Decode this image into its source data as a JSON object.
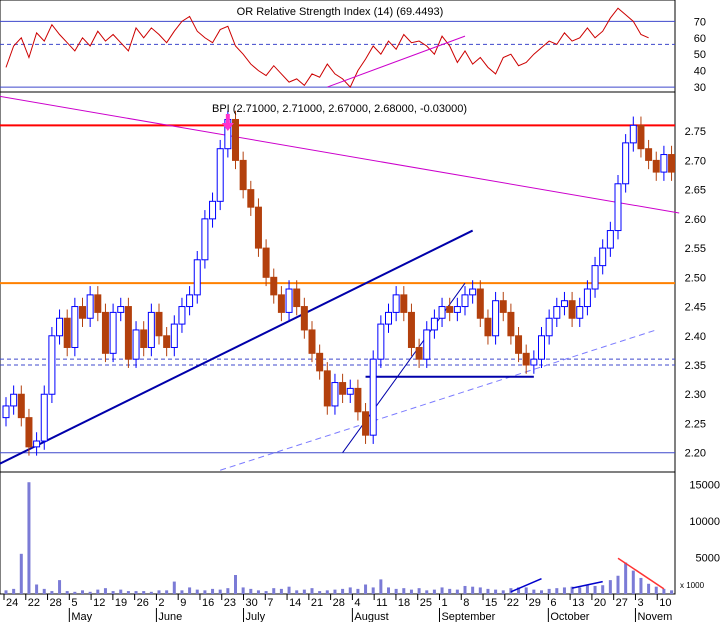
{
  "chart_data": [
    {
      "panel": "rsi",
      "type": "line",
      "title": "OR Relative Strength Index (14) (69.4493)",
      "y_ticks": [
        30,
        40,
        50,
        60,
        70
      ],
      "ylim": [
        27,
        83
      ],
      "reference_lines": [
        70,
        56,
        30
      ],
      "series": [
        {
          "values": [
            42,
            55,
            60,
            48,
            63,
            58,
            68,
            62,
            57,
            52,
            60,
            55,
            64,
            58,
            62,
            57,
            52,
            66,
            60,
            66,
            62,
            57,
            64,
            70,
            73,
            64,
            60,
            57,
            65,
            67,
            55,
            50,
            44,
            40,
            37,
            43,
            38,
            33,
            35,
            31,
            38,
            36,
            44,
            38,
            35,
            30,
            40,
            47,
            55,
            50,
            58,
            53,
            62,
            57,
            58,
            55,
            50,
            61,
            55,
            45,
            52,
            44,
            48,
            42,
            38,
            48,
            50,
            43,
            45,
            50,
            54,
            58,
            56,
            63,
            58,
            60,
            66,
            60,
            64,
            72,
            78,
            74,
            70,
            62,
            60
          ]
        }
      ],
      "trendlines": [
        {
          "from": [
            42,
            30
          ],
          "to": [
            60,
            61
          ]
        }
      ]
    },
    {
      "panel": "price",
      "type": "candlestick",
      "title": "BPI (2.71000, 2.71000, 2.67000, 2.68000, -0.03000)",
      "y_ticks": [
        2.2,
        2.25,
        2.3,
        2.35,
        2.4,
        2.45,
        2.5,
        2.55,
        2.6,
        2.65,
        2.7,
        2.75
      ],
      "ylim": [
        2.167,
        2.817
      ],
      "close": [
        2.28,
        2.3,
        2.26,
        2.21,
        2.22,
        2.3,
        2.4,
        2.43,
        2.38,
        2.45,
        2.43,
        2.47,
        2.44,
        2.37,
        2.44,
        2.45,
        2.36,
        2.41,
        2.38,
        2.44,
        2.4,
        2.38,
        2.42,
        2.45,
        2.47,
        2.53,
        2.6,
        2.63,
        2.72,
        2.77,
        2.7,
        2.65,
        2.62,
        2.55,
        2.5,
        2.47,
        2.44,
        2.48,
        2.45,
        2.41,
        2.37,
        2.34,
        2.28,
        2.32,
        2.3,
        2.31,
        2.27,
        2.23,
        2.36,
        2.42,
        2.44,
        2.47,
        2.44,
        2.38,
        2.36,
        2.41,
        2.43,
        2.45,
        2.44,
        2.45,
        2.47,
        2.48,
        2.43,
        2.4,
        2.46,
        2.44,
        2.4,
        2.37,
        2.35,
        2.36,
        2.4,
        2.43,
        2.45,
        2.46,
        2.43,
        2.45,
        2.48,
        2.52,
        2.55,
        2.58,
        2.66,
        2.73,
        2.76,
        2.72,
        2.7,
        2.68,
        2.71,
        2.68
      ]
    },
    {
      "panel": "volume",
      "type": "bar",
      "y_ticks": [
        5000,
        10000,
        15000
      ],
      "ylim": [
        0,
        16700
      ],
      "unit_label": "x 1000",
      "values": [
        500,
        700,
        5500,
        15300,
        1300,
        700,
        400,
        1900,
        400,
        300,
        500,
        300,
        600,
        800,
        400,
        600,
        400,
        400,
        400,
        300,
        500,
        500,
        1700,
        500,
        900,
        600,
        500,
        700,
        600,
        800,
        2600,
        900,
        700,
        500,
        400,
        800,
        700,
        1000,
        500,
        600,
        800,
        400,
        500,
        600,
        700,
        900,
        700,
        1300,
        900,
        2000,
        900,
        700,
        800,
        600,
        800,
        500,
        600,
        900,
        700,
        600,
        1100,
        1000,
        900,
        700,
        600,
        500,
        800,
        900,
        900,
        600,
        500,
        700,
        800,
        900,
        1000,
        900,
        1200,
        1100,
        1200,
        1900,
        2500,
        4300,
        3200,
        2200,
        1400,
        1000,
        700,
        500
      ],
      "trendlines": [
        {
          "from": [
            66,
            300
          ],
          "to": [
            70,
            2100
          ]
        },
        {
          "from": [
            74,
            800
          ],
          "to": [
            78,
            1700
          ]
        },
        {
          "from": [
            80,
            4900
          ],
          "to": [
            86,
            700
          ]
        }
      ]
    }
  ],
  "x_axis": {
    "day_ticks": [
      "24",
      "22",
      "28",
      "5",
      "12",
      "19",
      "26",
      "2",
      "9",
      "16",
      "23",
      "30",
      "7",
      "14",
      "21",
      "28",
      "4",
      "11",
      "18",
      "25",
      "1",
      "8",
      "15",
      "22",
      "29",
      "6",
      "13",
      "20",
      "27",
      "3",
      "10"
    ],
    "month_labels": [
      "May",
      "June",
      "July",
      "August",
      "September",
      "October",
      "Novem"
    ]
  },
  "annotations": {
    "arrow_color": "#ff33cc",
    "level_lines": [
      {
        "value": 2.76,
        "color": "#ff0000"
      },
      {
        "value": 2.49,
        "color": "#ff8000"
      },
      {
        "value": 2.2,
        "color": "#3f48cc"
      },
      {
        "value": 2.36,
        "color": "#3f48cc",
        "dashed": true
      },
      {
        "value": 2.35,
        "color": "#3f48cc",
        "dashed": true
      }
    ],
    "trendlines": [
      {
        "from": [
          -1,
          2.81
        ],
        "to": [
          88,
          2.61
        ],
        "color": "#cc00cc"
      },
      {
        "from": [
          -1,
          2.18
        ],
        "to": [
          61,
          2.58
        ],
        "color": "#0000aa",
        "width": 2
      },
      {
        "from": [
          44,
          2.2
        ],
        "to": [
          60,
          2.49
        ],
        "color": "#0000aa",
        "width": 1
      },
      {
        "from": [
          28,
          2.17
        ],
        "to": [
          85,
          2.41
        ],
        "color": "#7b7bff",
        "dashed": true
      },
      {
        "from": [
          47,
          2.33
        ],
        "to": [
          69,
          2.33
        ],
        "color": "#0000aa",
        "width": 2
      }
    ]
  },
  "colors": {
    "up": "#0000ff",
    "down": "#b3400d",
    "rsi_line": "#cc0000",
    "volume": "#7b7bd6",
    "grid_blue": "#3f48cc"
  }
}
